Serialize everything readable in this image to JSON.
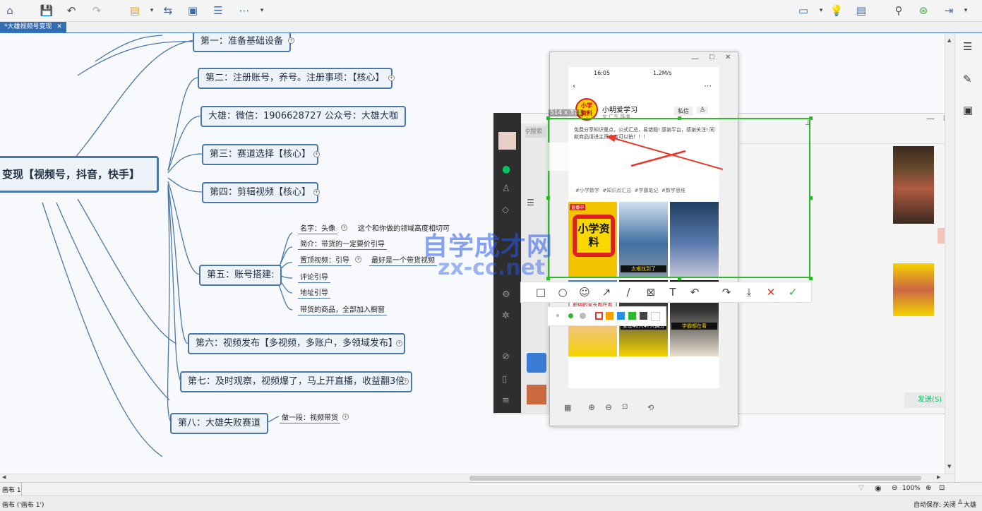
{
  "app": {
    "doc_tab": "*大雄视频号变现"
  },
  "mindmap": {
    "root": "变现【视频号，抖音，快手】",
    "branches": [
      "第一：准备基础设备",
      "第二：注册账号，养号。注册事项：【核心】",
      "大雄：微信：1906628727   公众号：大雄大咖",
      "第三：赛道选择【核心】",
      "第四：剪辑视频【核心】",
      "第五：账号搭建:",
      "第六：视频发布【多视频，多账户，多领域发布】",
      "第七：及时观察，视频爆了，马上开直播，收益翻3倍",
      "第八：大雄失败赛道"
    ],
    "account_items": [
      {
        "label": "名字：头像",
        "note": "这个和你做的领域高度相切可"
      },
      {
        "label": "简介：带货的一定要价引导",
        "note": ""
      },
      {
        "label": "置顶视频：引导",
        "note": "最好是一个带货视频"
      },
      {
        "label": "评论引导",
        "note": ""
      },
      {
        "label": "地址引导",
        "note": ""
      },
      {
        "label": "带货的商品，全部加入橱窗",
        "note": ""
      }
    ],
    "failure_item": "做一段：视频带货"
  },
  "phone": {
    "time": "16:05",
    "net": "1.2M/s",
    "profile_name": "小明爱学习",
    "location": "女 广东 珠海",
    "avatar_text": "小学资料",
    "private_msg": "私信",
    "bio": "免费分享知识重点，公式汇总，易错题! 感谢平台，感谢关注! 同款商品请进主页商店可以拍！！！",
    "tags": [
      "#小学数学",
      "#知识点汇总",
      "#学霸笔记",
      "#数学思维"
    ],
    "live_badge": "直播中",
    "big_thumb_text": "小学资料",
    "thumb_captions": [
      "太难找到了",
      "聪明的家长都在看",
      "学霸都在看",
      "全班48人47人满分"
    ]
  },
  "snapshot": {
    "size_label": "514 x 311"
  },
  "wechat": {
    "search_placeholder": "搜索",
    "send_button": "发送(S)"
  },
  "watermark": {
    "line1": "自学成才网",
    "line2": "zx-cc.net"
  },
  "status": {
    "canvas_label": "画布 1",
    "canvas_path": "画布 ('画布 1')",
    "zoom": "100%",
    "autosave": "自动保存: 关闭",
    "user": "大雄"
  },
  "colors": {
    "accent": "#2f6db5",
    "node_border": "#4a77a8",
    "selection": "#2eb82e",
    "arrow": "#e8392b"
  }
}
